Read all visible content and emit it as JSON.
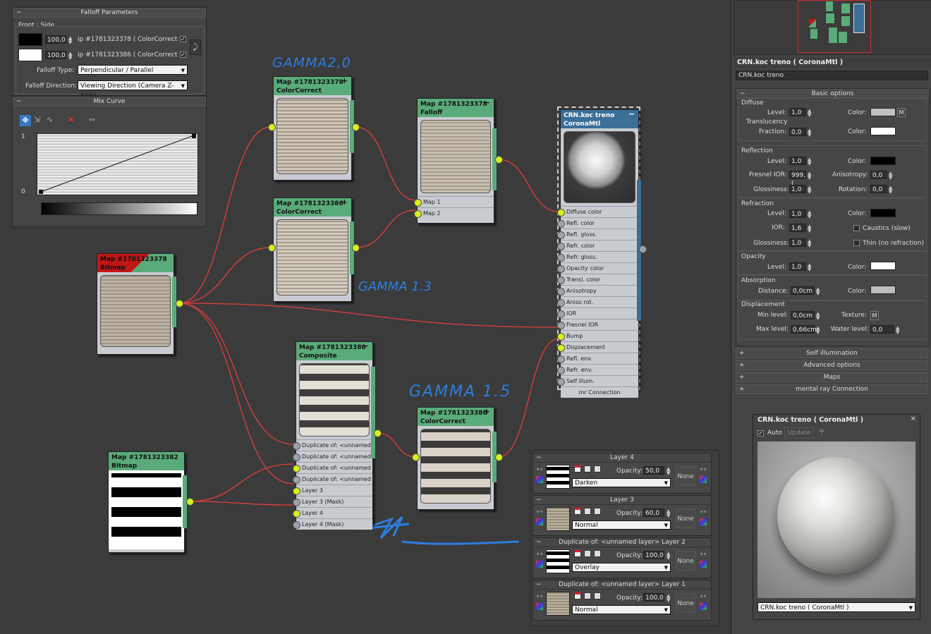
{
  "falloff": {
    "title": "Falloff Parameters",
    "front_side": "Front : Side",
    "row1_value": "100,0",
    "row1_map": "ip #1781323378  ( ColorCorrect )",
    "row2_value": "100,0",
    "row2_map": "ip #1781323386  ( ColorCorrect )",
    "falloff_type_label": "Falloff Type:",
    "falloff_type_value": "Perpendicular / Parallel",
    "falloff_dir_label": "Falloff Direction:",
    "falloff_dir_value": "Viewing Direction (Camera Z-Axis)",
    "mix_curve_title": "Mix Curve",
    "curve_y_top": "1",
    "curve_y_bottom": "0",
    "colors": {
      "row1_swatch": "#000000",
      "row2_swatch": "#ffffff"
    }
  },
  "annotations": {
    "gamma_top": "GAMMA2,0",
    "gamma_mid": "GAMMA 1.3",
    "gamma_low": "GAMMA 1.5"
  },
  "nodes": {
    "bitmap1": {
      "title": "Map #1781323378",
      "type": "Bitmap"
    },
    "cc1": {
      "title": "Map #1781323378",
      "type": "ColorCorrect"
    },
    "cc2": {
      "title": "Map #1781323386",
      "type": "ColorCorrect"
    },
    "falloff": {
      "title": "Map #1781323378",
      "type": "Falloff",
      "slots": [
        "Map 1",
        "Map 2"
      ]
    },
    "composite": {
      "title": "Map #1781323380",
      "type": "Composite",
      "slots": [
        "Duplicate of: <unnamed l...",
        "Duplicate of: <unnamed l...",
        "Duplicate of: <unnamed l...",
        "Duplicate of: <unnamed l...",
        "Layer 3",
        "Layer 3 (Mask)",
        "Layer 4",
        "Layer 4 (Mask)"
      ]
    },
    "bitmap2": {
      "title": "Map #1781323382",
      "type": "Bitmap"
    },
    "cc3": {
      "title": "Map #1781323380",
      "type": "ColorCorrect"
    },
    "material": {
      "title": "CRN.koc treno",
      "type": "CoronaMtl",
      "slots": [
        "Diffuse color",
        "Refl. color",
        "Refl. gloss.",
        "Refr. color",
        "Refr. gloss.",
        "Opacity color",
        "Transl. color",
        "Anisotropy",
        "Aniso rot.",
        "IOR",
        "Fresnel IOR",
        "Bump",
        "Displacement",
        "Refl. env.",
        "Refr. env.",
        "Self illum."
      ],
      "footer": "mr Connection"
    }
  },
  "layers": [
    {
      "title": "Layer 4",
      "opacity_label": "Opacity:",
      "opacity": "50,0",
      "blend": "Darken",
      "none": "None"
    },
    {
      "title": "Layer 3",
      "opacity_label": "Opacity:",
      "opacity": "60,0",
      "blend": "Normal",
      "none": "None"
    },
    {
      "title": "Duplicate of: <unnamed layer> Layer 2",
      "opacity_label": "Opacity:",
      "opacity": "100,0",
      "blend": "Overlay",
      "none": "None"
    },
    {
      "title": "Duplicate of: <unnamed layer> Layer 1",
      "opacity_label": "Opacity:",
      "opacity": "100,0",
      "blend": "Normal",
      "none": "None"
    }
  ],
  "right": {
    "header": "CRN.koc treno  ( CoronaMtl )",
    "name_field": "CRN.koc treno",
    "basic_options": "Basic options",
    "diffuse": "Diffuse",
    "level": "Level:",
    "level_val": "1,0",
    "color": "Color:",
    "translucency": "Translucency",
    "fraction": "Fraction:",
    "fraction_val": "0,0",
    "reflection": "Reflection",
    "refl_level_val": "1,0",
    "fresnel_ior": "Fresnel IOR:",
    "fresnel_val": "999,(",
    "anisotropy": "Anisotropy:",
    "aniso_val": "0,0",
    "glossiness": "Glossiness:",
    "gloss_val": "1,0",
    "rotation": "Rotation:",
    "rot_val": "0,0",
    "refraction": "Refraction",
    "refr_level_val": "1,0",
    "ior": "IOR:",
    "ior_val": "1,6",
    "caustics": "Caustics (slow)",
    "refr_gloss_val": "1,0",
    "thin": "Thin (no refraction)",
    "opacity": "Opacity",
    "opacity_level_val": "1,0",
    "absorption": "Absorption",
    "distance": "Distance:",
    "distance_val": "0,0cm",
    "displacement": "Displacement",
    "min_level": "Min level:",
    "min_val": "0,0cm",
    "texture": "Texture:",
    "max_level": "Max level:",
    "max_val": "0,66cm",
    "water_level": "Water level:",
    "water_val": "0,0",
    "m": "M",
    "rollouts": [
      "Self illumination",
      "Advanced options",
      "Maps",
      "mental ray Connection"
    ],
    "preview_title": "CRN.koc treno  ( CoronaMtl )",
    "auto": "Auto",
    "update": "Update",
    "preview_dropdown": "CRN.koc treno  ( CoronaMtl )",
    "colors": {
      "diffuse": "#c0c0c0",
      "translucency": "#ffffff",
      "refl": "#000000",
      "refr": "#000000",
      "opacity": "#ffffff",
      "absorption": "#bdbdbd"
    }
  }
}
